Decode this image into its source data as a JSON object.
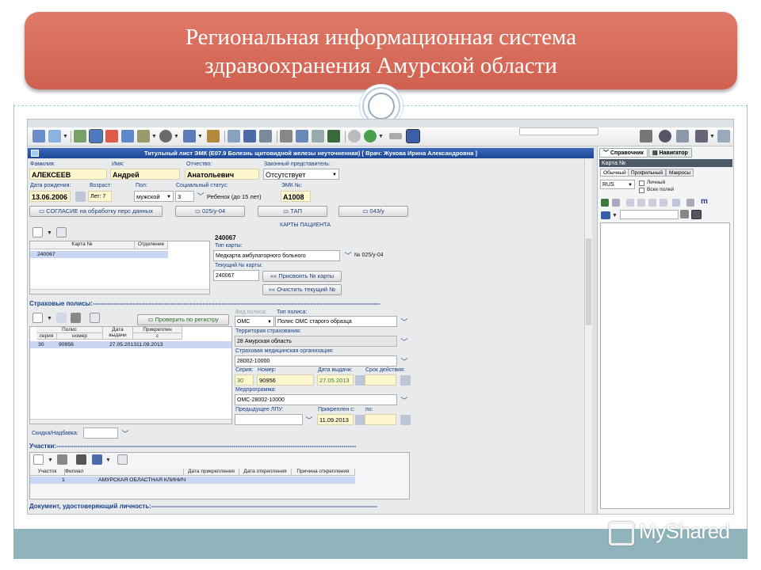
{
  "slide": {
    "title_line1": "Региональная информационная система",
    "title_line2": "здравоохранения Амурской области",
    "watermark": "MyShared"
  },
  "window": {
    "title": "Титульный лист ЭМК (E07.9 Болезнь щитовидной железы неуточненная)  [ Врач: Жукова Ирина Александровна ]"
  },
  "patient": {
    "lastname_label": "Фамилия:",
    "lastname": "АЛЕКСЕЕВ",
    "firstname_label": "Имя:",
    "firstname": "Андрей",
    "middlename_label": "Отчество:",
    "middlename": "Анатольевич",
    "rep_label": "Законный представитель:",
    "rep_value": "Отсутствует",
    "dob_label": "Дата рождения:",
    "dob": "13.06.2006",
    "age_label": "Возраст:",
    "age_prefix": "Лет:",
    "age": "7",
    "sex_label": "Пол:",
    "sex": "мужской",
    "social_label": "Социальный статус:",
    "social_code": "3",
    "social_text": "Ребенок (до 15 лет)",
    "emk_label": "ЭМК №:",
    "emk": "A1008"
  },
  "buttons": {
    "consent": "СОГЛАСИЕ на обработку перс данных",
    "f025": "025/у-04",
    "tap": "ТАП",
    "f043": "043/у",
    "assign": "Присвоить № карты",
    "clear": "Очистить текущий №",
    "check_registry": "Проверить по регистру"
  },
  "cards": {
    "section": "КАРТЫ ПАЦИЕНТА",
    "col_card": "Карта №",
    "col_dept": "Отделение",
    "row_card": "240067",
    "number": "240067",
    "type_label": "Тип карты:",
    "type": "Медкарта амбулаторного больного",
    "type_code": "№ 025/у-04",
    "current_label": "Текущий № карты:",
    "current": "240067"
  },
  "policies": {
    "section": "Страховые полисы:----------------------------------------------------------------------------------------------------------------------------------------",
    "col_policy": "Полис",
    "col_series": "серия",
    "col_number": "номер",
    "col_issue": "Дата выдачи",
    "col_attached": "Прикреплен",
    "col_from": "с",
    "row": {
      "series": "30",
      "number": "90956",
      "issue": "27.05.2013",
      "from": "11.09.2013"
    },
    "kind_label": "Вид полиса:",
    "kind": "ОМС",
    "type_label": "Тип полиса:",
    "type": "Полис ОМС старого образца",
    "territory_label": "Территория страхования:",
    "territory": "28 Амурская область",
    "org_label": "Страховая медицинская организация:",
    "org": "28002-10000",
    "series_label": "Серия:",
    "series": "30",
    "number_label": "Номер:",
    "number": "90956",
    "issue_label": "Дата выдачи:",
    "issue": "27.05.2013",
    "valid_label": "Срок действия:",
    "program_label": "Медпрограмма:",
    "program": "ОМС-28002-10000",
    "prev_label": "Предыдущее ЛПУ:",
    "attached_label": "Прикреплен с:",
    "attached": "11.09.2013",
    "to_label": "по:"
  },
  "discount": {
    "label": "Скидка/Надбавка:"
  },
  "districts": {
    "section": "Участки:----------------------------------------------------------------------------------------------------------------------------------------------",
    "col_district": "Участок",
    "col_branch": "Филиал",
    "col_attach": "Дата прикрепления",
    "col_detach": "Дата открепления",
    "col_reason": "Причина открепления",
    "row_district": "1",
    "row_branch": "АМУРСКАЯ ОБЛАСТНАЯ КЛИНИЧ"
  },
  "doc_section": "Документ, удостоверяющий личность:-----------------------------------------------------------------------------------------------------------",
  "side": {
    "tab_ref": "Справочник",
    "tab_nav": "Навигатор",
    "header": "Карта №",
    "sub_normal": "Обычный",
    "sub_profile": "Профильный",
    "sub_macro": "Макросы",
    "lang": "RUS",
    "chk_personal": "Личный",
    "chk_all": "Всех полей"
  },
  "colors": {
    "accent": "#1b3f86",
    "title_bg": "#d9695a",
    "selected_row": "#c9d7f2"
  }
}
